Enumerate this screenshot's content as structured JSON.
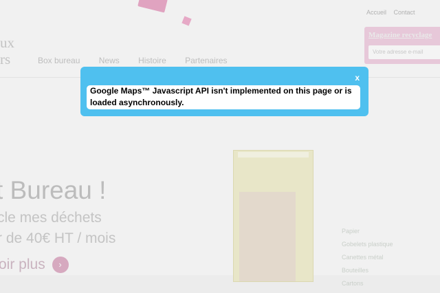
{
  "topbar": {
    "links": [
      "Accueil",
      "Contact"
    ]
  },
  "site": {
    "logo_line1": "ux",
    "logo_line2": "rs"
  },
  "nav": {
    "items": [
      "Box bureau",
      "News",
      "Histoire",
      "Partenaires"
    ]
  },
  "magazine": {
    "title": "Magazine recyclage",
    "input_placeholder": "Votre adresse e-mail"
  },
  "hero": {
    "title": "t Bureau !",
    "line1": "cle mes déchets",
    "line2": "r de 40€ HT / mois",
    "more": "oir plus",
    "more_arrow": "›"
  },
  "checklist": {
    "items": [
      "Papier",
      "Gobelets plastique",
      "Canettes métal",
      "Bouteilles",
      "Cartons"
    ]
  },
  "popup": {
    "close_label": "x",
    "message": "Google Maps™ Javascript API isn't implemented on this page or is loaded asynchronously."
  }
}
